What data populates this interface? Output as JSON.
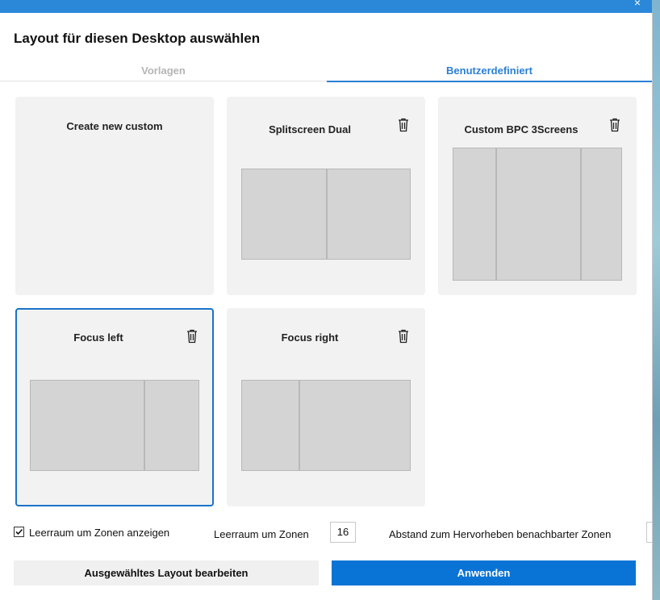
{
  "dialog": {
    "title": "Layout für diesen Desktop auswählen"
  },
  "tabs": [
    {
      "label": "Vorlagen",
      "active": false
    },
    {
      "label": "Benutzerdefiniert",
      "active": true
    }
  ],
  "layouts": [
    {
      "title": "Create new custom",
      "deletable": false,
      "selected": false,
      "zones": []
    },
    {
      "title": "Splitscreen Dual",
      "deletable": true,
      "selected": false,
      "zones": [
        "left",
        "right"
      ]
    },
    {
      "title": "Custom BPC 3Screens",
      "deletable": true,
      "selected": false,
      "zones": [
        "left",
        "center",
        "right"
      ]
    },
    {
      "title": "Focus left",
      "deletable": true,
      "selected": true,
      "zones": [
        "left",
        "right"
      ]
    },
    {
      "title": "Focus right",
      "deletable": true,
      "selected": false,
      "zones": [
        "left",
        "right"
      ]
    }
  ],
  "settings": {
    "show_spacing_label": "Leerraum um Zonen anzeigen",
    "show_spacing_checked": true,
    "spacing_label": "Leerraum um Zonen",
    "spacing_value": "16",
    "distance_label": "Abstand zum Hervorheben benachbarter Zonen",
    "distance_value": ""
  },
  "buttons": {
    "edit_label": "Ausgewähltes Layout bearbeiten",
    "apply_label": "Anwenden"
  },
  "colors": {
    "accent": "#0a74d6",
    "tab_active": "#2b7fd4",
    "card_bg": "#f2f2f2",
    "zone_fill": "#d4d4d4"
  }
}
